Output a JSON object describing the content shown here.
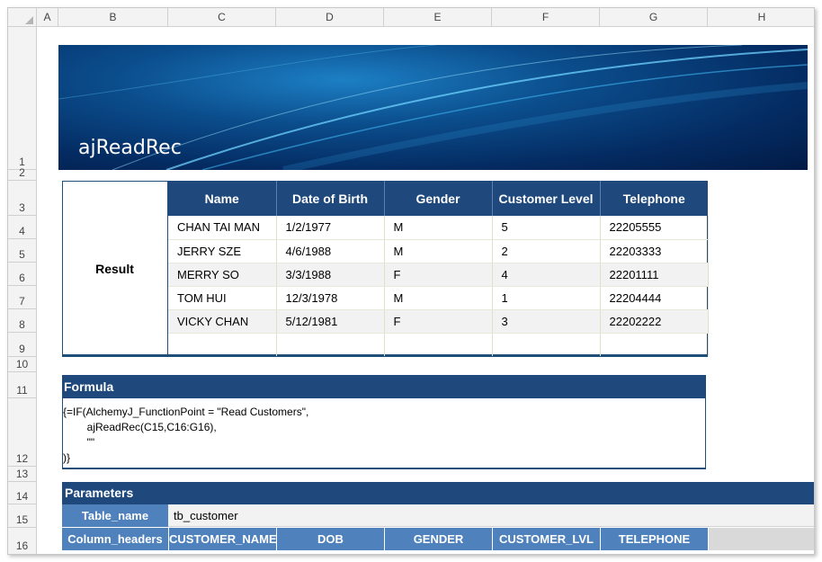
{
  "columns": [
    "A",
    "B",
    "C",
    "D",
    "E",
    "F",
    "G",
    "H"
  ],
  "rows": [
    "1",
    "2",
    "3",
    "4",
    "5",
    "6",
    "7",
    "8",
    "9",
    "10",
    "11",
    "12",
    "13",
    "14",
    "15",
    "16"
  ],
  "banner": {
    "title": "ajReadRec"
  },
  "result": {
    "label": "Result",
    "headers": [
      "Name",
      "Date of Birth",
      "Gender",
      "Customer Level",
      "Telephone"
    ],
    "rows": [
      [
        "CHAN TAI MAN",
        "1/2/1977",
        "M",
        "5",
        "22205555"
      ],
      [
        "JERRY SZE",
        "4/6/1988",
        "M",
        "2",
        "22203333"
      ],
      [
        "MERRY SO",
        "3/3/1988",
        "F",
        "4",
        "22201111"
      ],
      [
        "TOM HUI",
        "12/3/1978",
        "M",
        "1",
        "22204444"
      ],
      [
        "VICKY CHAN",
        "5/12/1981",
        "F",
        "3",
        "22202222"
      ],
      [
        "",
        "",
        "",
        "",
        ""
      ]
    ]
  },
  "formula": {
    "header": "Formula",
    "lines": [
      "{=IF(AlchemyJ_FunctionPoint = \"Read Customers\",",
      "        ajReadRec(C15,C16:G16),",
      "        \"\"",
      ")}"
    ]
  },
  "parameters": {
    "header": "Parameters",
    "table_name_label": "Table_name",
    "table_name_value": "tb_customer",
    "column_headers_label": "Column_headers",
    "column_headers": [
      "CUSTOMER_NAME",
      "DOB",
      "GENDER",
      "CUSTOMER_LVL",
      "TELEPHONE"
    ]
  },
  "colors": {
    "header_dark_blue": "#1f497d",
    "param_blue": "#4f81bd",
    "banner_blue": "#0b4d8c"
  }
}
